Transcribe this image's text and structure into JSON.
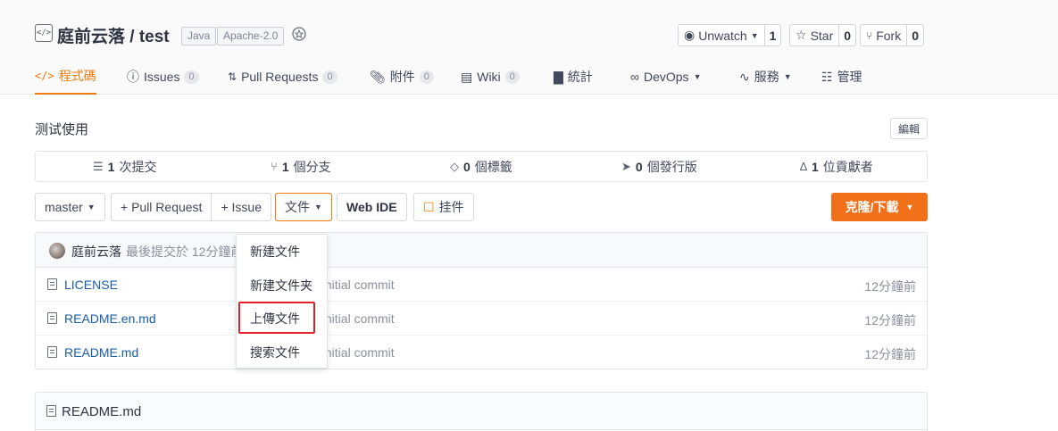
{
  "repo": {
    "owner": "庭前云落",
    "name": "test",
    "title": "庭前云落 / test",
    "badges": [
      "Java",
      "Apache-2.0"
    ]
  },
  "actions": {
    "watch_label": "Unwatch",
    "watch_count": "1",
    "star_label": "Star",
    "star_count": "0",
    "fork_label": "Fork",
    "fork_count": "0"
  },
  "tabs": [
    {
      "label": "程式碼",
      "icon": "code-icon",
      "active": true
    },
    {
      "label": "Issues",
      "count": "0",
      "icon": "issue-icon"
    },
    {
      "label": "Pull Requests",
      "count": "0",
      "icon": "pull-request-icon"
    },
    {
      "label": "附件",
      "count": "0",
      "icon": "attachment-icon"
    },
    {
      "label": "Wiki",
      "count": "0",
      "icon": "wiki-icon"
    },
    {
      "label": "統計",
      "icon": "chart-icon"
    },
    {
      "label": "DevOps",
      "icon": "devops-icon",
      "dropdown": true
    },
    {
      "label": "服務",
      "icon": "pulse-icon",
      "dropdown": true
    },
    {
      "label": "管理",
      "icon": "manage-icon"
    }
  ],
  "description": "测试使用",
  "edit_label": "編輯",
  "stats": [
    {
      "count": "1",
      "label": "次提交",
      "icon": "commit-icon"
    },
    {
      "count": "1",
      "label": "個分支",
      "icon": "branch-icon"
    },
    {
      "count": "0",
      "label": "個標籤",
      "icon": "tag-icon"
    },
    {
      "count": "0",
      "label": "個發行版",
      "icon": "release-icon"
    },
    {
      "count": "1",
      "label": "位貢獻者",
      "icon": "contributors-icon"
    }
  ],
  "toolbar": {
    "branch": "master",
    "pull_request": "+ Pull Request",
    "issue": "+ Issue",
    "file": "文件",
    "web_ide": "Web IDE",
    "pin": "挂件",
    "clone": "克隆/下載"
  },
  "commit": {
    "author": "庭前云落",
    "meta": "最後提交於 12分鐘前"
  },
  "files": [
    {
      "name": "LICENSE",
      "message": "Initial commit",
      "time": "12分鐘前"
    },
    {
      "name": "README.en.md",
      "message": "Initial commit",
      "time": "12分鐘前"
    },
    {
      "name": "README.md",
      "message": "Initial commit",
      "time": "12分鐘前"
    }
  ],
  "file_menu": [
    "新建文件",
    "新建文件夹",
    "上傳文件",
    "搜索文件"
  ],
  "readme": {
    "title": "README.md"
  },
  "colors": {
    "accent": "#f07a0e",
    "clone_button": "#f1711b",
    "link": "#1a5da8",
    "highlight": "#e0202a"
  }
}
